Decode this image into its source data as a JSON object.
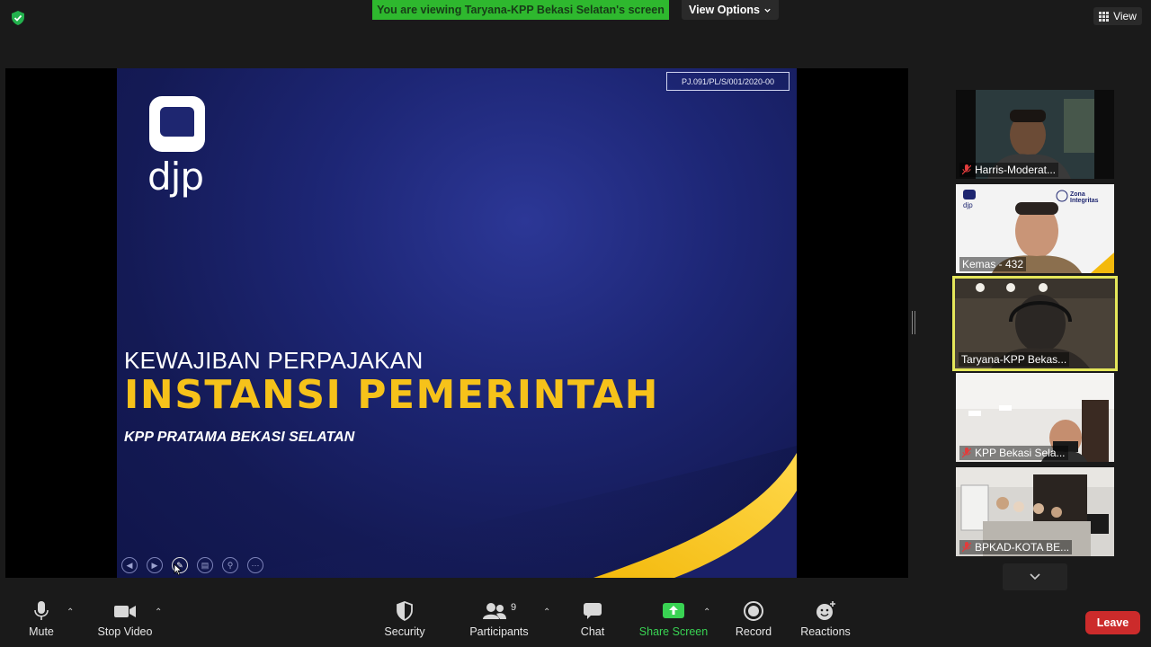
{
  "top_bar": {
    "banner_text": "You are viewing Taryana-KPP Bekasi Selatan's screen",
    "view_options_label": "View Options",
    "view_label": "View"
  },
  "slide": {
    "code": "PJ.091/PL/S/001/2020-00",
    "logo_text": "djp",
    "line1": "KEWAJIBAN PERPAJAKAN",
    "line2": "INSTANSI PEMERINTAH",
    "line3": "KPP PRATAMA BEKASI SELATAN",
    "colors": {
      "background": "#1d2675",
      "accent": "#f6c21a"
    }
  },
  "gallery": {
    "participants": [
      {
        "name": "Harris-Moderat...",
        "muted": true
      },
      {
        "name": "Kemas - 432",
        "muted": false,
        "overlay_badge": "Zona Integritas",
        "overlay_logo": "djp"
      },
      {
        "name": "Taryana-KPP Bekas...",
        "muted": false,
        "active_speaker": true
      },
      {
        "name": "KPP Bekasi Sela...",
        "muted": true
      },
      {
        "name": "BPKAD-KOTA BE...",
        "muted": true
      }
    ]
  },
  "toolbar": {
    "mute_label": "Mute",
    "stop_video_label": "Stop Video",
    "security_label": "Security",
    "participants_label": "Participants",
    "participants_count": "9",
    "chat_label": "Chat",
    "share_screen_label": "Share Screen",
    "record_label": "Record",
    "reactions_label": "Reactions",
    "leave_label": "Leave",
    "colors": {
      "share": "#39d353",
      "leave": "#cc2b2b"
    }
  }
}
